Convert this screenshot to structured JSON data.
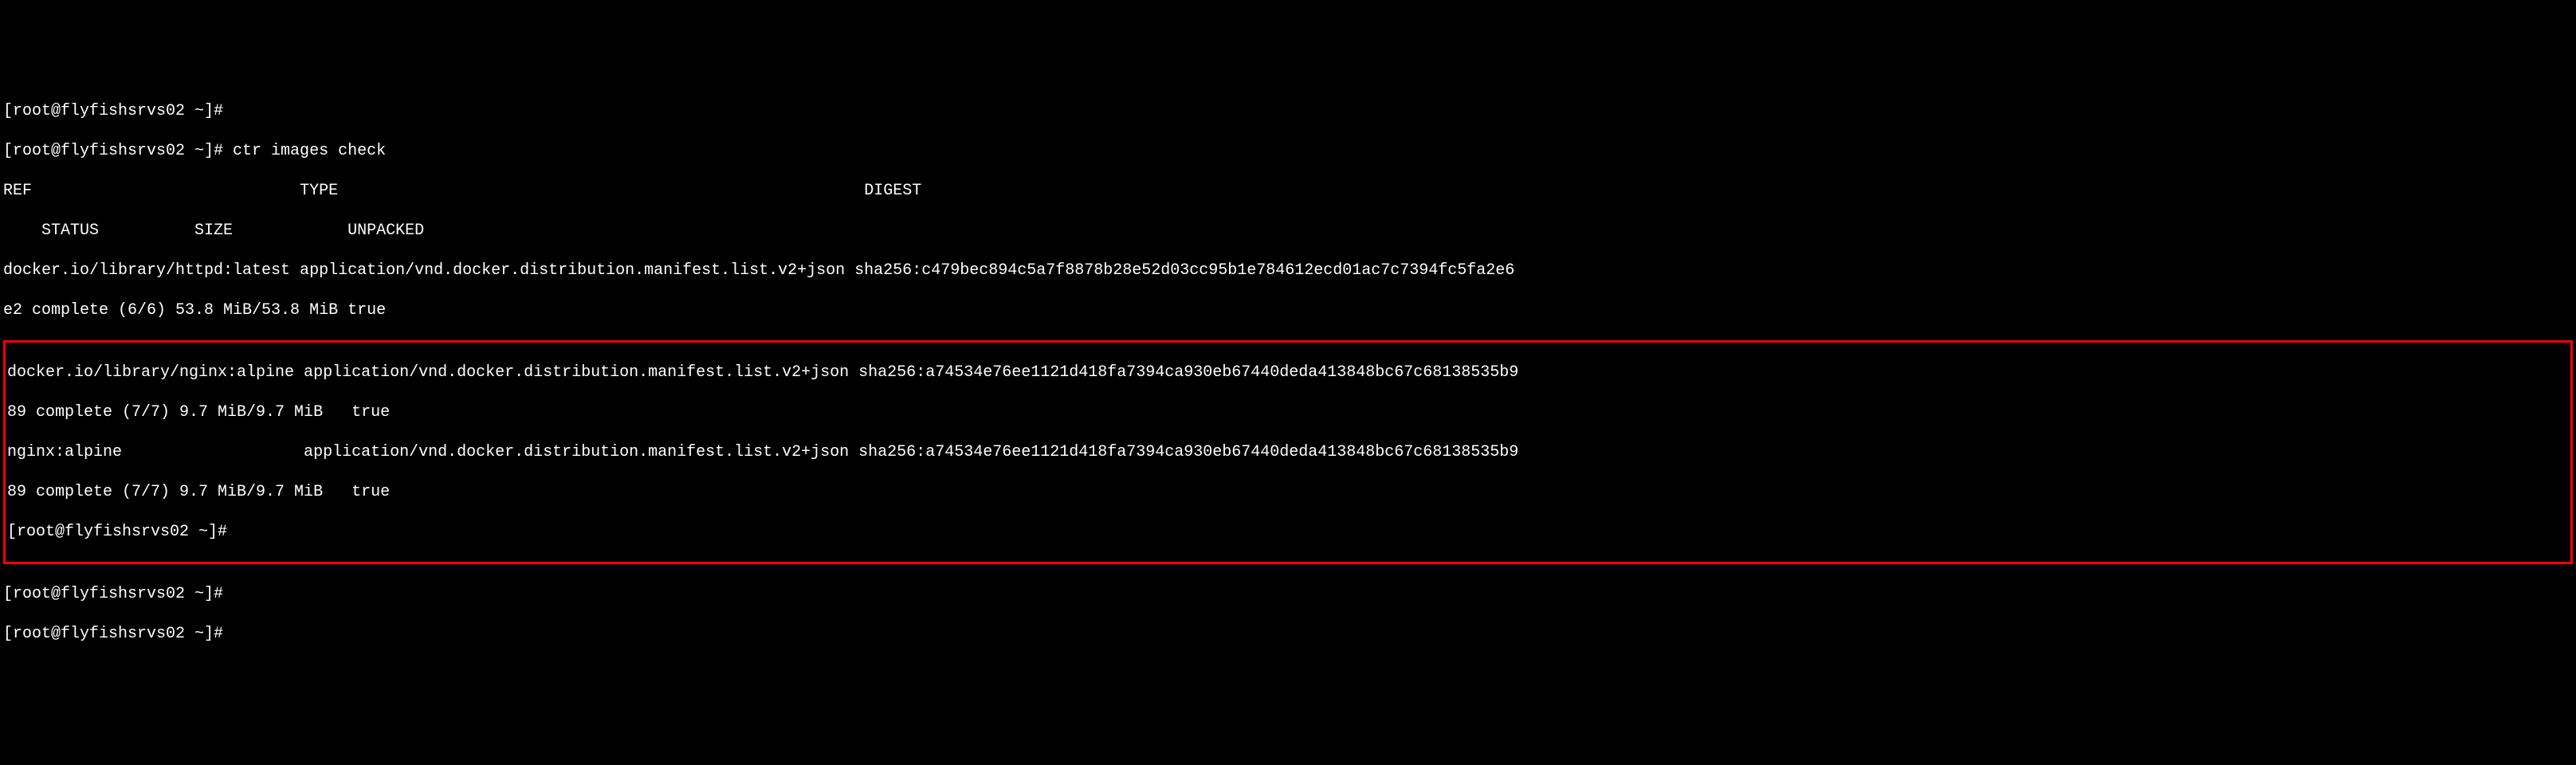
{
  "prompt1": "[root@flyfishsrvs02 ~]#",
  "prompt2": "[root@flyfishsrvs02 ~]# ctr images check",
  "header_ref": "REF",
  "header_type": "TYPE",
  "header_digest": "DIGEST",
  "header_status": "    STATUS          SIZE            UNPACKED",
  "image1_line1": "docker.io/library/httpd:latest application/vnd.docker.distribution.manifest.list.v2+json sha256:c479bec894c5a7f8878b28e52d03cc95b1e784612ecd01ac7c7394fc5fa2e6",
  "image1_line2": "e2 complete (6/6) 53.8 MiB/53.8 MiB true",
  "image2_line1": "docker.io/library/nginx:alpine application/vnd.docker.distribution.manifest.list.v2+json sha256:a74534e76ee1121d418fa7394ca930eb67440deda413848bc67c68138535b9",
  "image2_line2": "89 complete (7/7) 9.7 MiB/9.7 MiB   true",
  "image3_line1": "nginx:alpine                   application/vnd.docker.distribution.manifest.list.v2+json sha256:a74534e76ee1121d418fa7394ca930eb67440deda413848bc67c68138535b9",
  "image3_line2": "89 complete (7/7) 9.7 MiB/9.7 MiB   true",
  "prompt3": "[root@flyfishsrvs02 ~]#",
  "prompt4": "[root@flyfishsrvs02 ~]#",
  "prompt5": "[root@flyfishsrvs02 ~]#"
}
